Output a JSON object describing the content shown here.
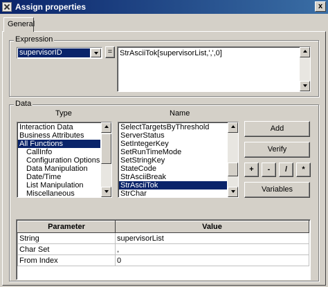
{
  "window": {
    "title": "Assign properties",
    "close_label": "x"
  },
  "tabs": [
    {
      "label": "General"
    }
  ],
  "expression": {
    "group_title": "Expression",
    "selected_variable": "supervisorID",
    "operator": "=",
    "value": "StrAsciiTok[supervisorList,',',0]"
  },
  "data": {
    "group_title": "Data",
    "type_header": "Type",
    "name_header": "Name",
    "types": [
      {
        "label": "Interaction Data",
        "selected": false,
        "indent": false
      },
      {
        "label": "Business Attributes",
        "selected": false,
        "indent": false
      },
      {
        "label": "All Functions",
        "selected": true,
        "indent": false
      },
      {
        "label": "CallInfo",
        "selected": false,
        "indent": true
      },
      {
        "label": "Configuration Options",
        "selected": false,
        "indent": true
      },
      {
        "label": "Data Manipulation",
        "selected": false,
        "indent": true
      },
      {
        "label": "Date/Time",
        "selected": false,
        "indent": true
      },
      {
        "label": "List Manipulation",
        "selected": false,
        "indent": true
      },
      {
        "label": "Miscellaneous",
        "selected": false,
        "indent": true
      }
    ],
    "names": [
      {
        "label": "SelectTargetsByThreshold",
        "selected": false
      },
      {
        "label": "ServerStatus",
        "selected": false
      },
      {
        "label": "SetIntegerKey",
        "selected": false
      },
      {
        "label": "SetRunTimeMode",
        "selected": false
      },
      {
        "label": "SetStringKey",
        "selected": false
      },
      {
        "label": "StateCode",
        "selected": false
      },
      {
        "label": "StrAsciiBreak",
        "selected": false
      },
      {
        "label": "StrAsciiTok",
        "selected": true
      },
      {
        "label": "StrChar",
        "selected": false
      }
    ],
    "buttons": {
      "add": "Add",
      "verify": "Verify",
      "plus": "+",
      "minus": "-",
      "divide": "/",
      "multiply": "*",
      "variables": "Variables"
    }
  },
  "parameters": {
    "headers": [
      "Parameter",
      "Value"
    ],
    "rows": [
      {
        "parameter": "String",
        "value": "supervisorList"
      },
      {
        "parameter": "Char Set",
        "value": ","
      },
      {
        "parameter": "From Index",
        "value": "0"
      }
    ]
  },
  "colors": {
    "selection": "#0a246a",
    "face": "#d4d0c8",
    "title_gradient_start": "#0a246a",
    "title_gradient_end": "#3a6ea5"
  }
}
